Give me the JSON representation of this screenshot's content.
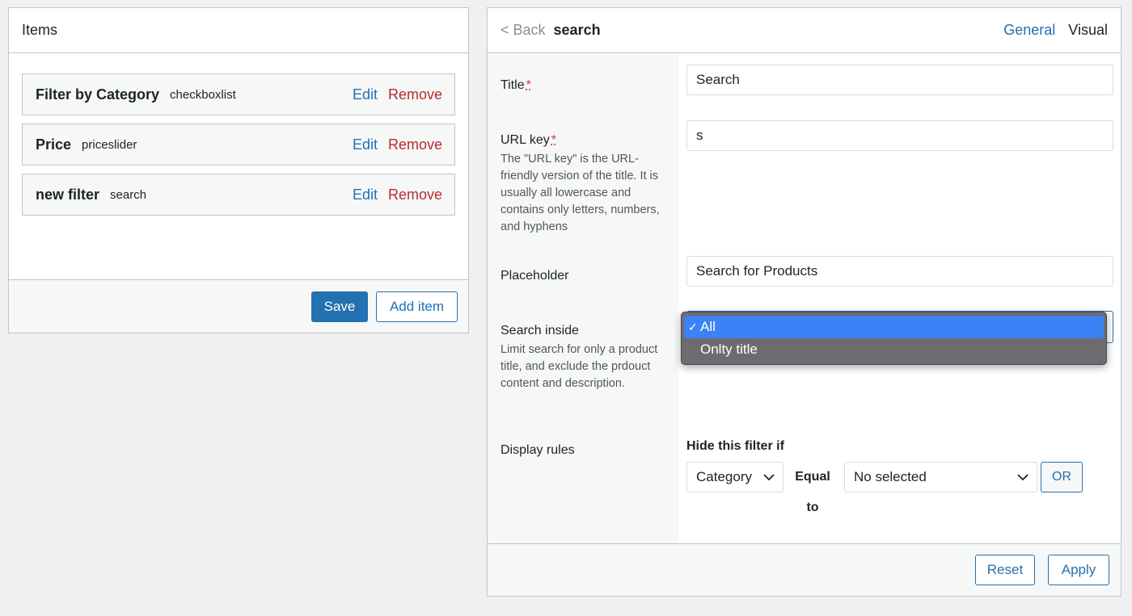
{
  "items_panel": {
    "title": "Items",
    "items": [
      {
        "name": "Filter by Category",
        "type": "checkboxlist",
        "edit_label": "Edit",
        "remove_label": "Remove"
      },
      {
        "name": "Price",
        "type": "priceslider",
        "edit_label": "Edit",
        "remove_label": "Remove"
      },
      {
        "name": "new filter",
        "type": "search",
        "edit_label": "Edit",
        "remove_label": "Remove"
      }
    ],
    "save_label": "Save",
    "add_item_label": "Add item"
  },
  "editor": {
    "back_label": "< Back",
    "title": "search",
    "tabs": [
      {
        "label": "General",
        "active": true
      },
      {
        "label": "Visual",
        "active": false
      }
    ],
    "fields": {
      "title": {
        "label": "Title",
        "required_mark": "*",
        "value": "Search"
      },
      "url_key": {
        "label": "URL key",
        "required_mark": "*",
        "description": "The \"URL key\" is the URL-friendly version of the title. It is usually all lowercase and contains only letters, numbers, and hyphens",
        "value": "s"
      },
      "placeholder": {
        "label": "Placeholder",
        "value": "Search for Products"
      },
      "search_inside": {
        "label": "Search inside",
        "description": "Limit search for only a product title, and exclude the prdouct content and description.",
        "options": [
          "All",
          "Onlty title"
        ],
        "selected": "All",
        "check_mark": "✓"
      },
      "display_rules": {
        "label": "Display rules",
        "heading": "Hide this filter if",
        "field_value": "Category",
        "operator_line1": "Equal",
        "operator_line2": "to",
        "value_value": "No selected",
        "or_label": "OR"
      }
    },
    "reset_label": "Reset",
    "apply_label": "Apply"
  },
  "colors": {
    "accent": "#2271b1",
    "danger": "#b32d2e",
    "dropdown_bg": "#6c6c70",
    "dropdown_highlight": "#3b82f6"
  }
}
